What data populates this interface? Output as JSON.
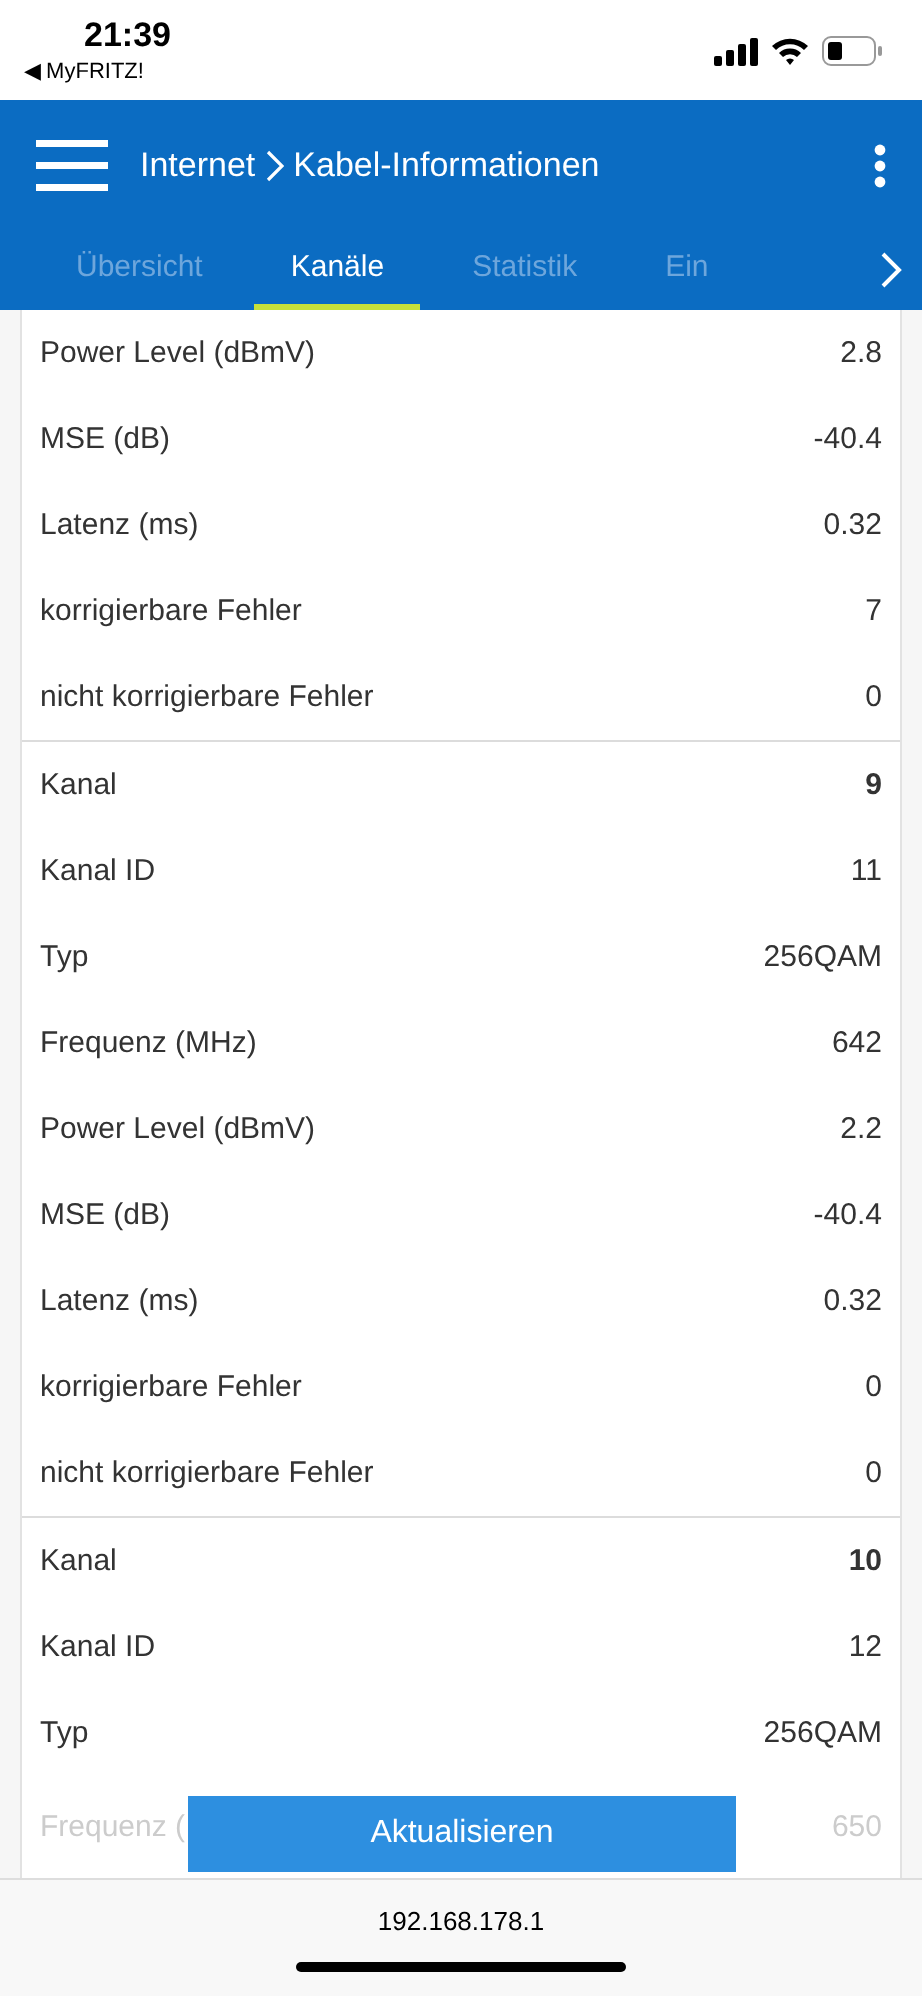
{
  "status_bar": {
    "time": "21:39",
    "back_app": "◀ MyFRITZ!"
  },
  "header": {
    "section": "Internet",
    "title": "Kabel-Informationen"
  },
  "tabs": [
    {
      "label": "Übersicht",
      "selected": false
    },
    {
      "label": "Kanäle",
      "selected": true
    },
    {
      "label": "Statistik",
      "selected": false
    },
    {
      "label": "Ein",
      "selected": false
    }
  ],
  "groups": [
    {
      "rows": [
        {
          "kind": "field",
          "label": "Power Level (dBmV)",
          "value": "2.8"
        },
        {
          "kind": "field",
          "label": "MSE (dB)",
          "value": "-40.4"
        },
        {
          "kind": "field",
          "label": "Latenz (ms)",
          "value": "0.32"
        },
        {
          "kind": "field",
          "label": "korrigierbare Fehler",
          "value": "7"
        },
        {
          "kind": "field",
          "label": "nicht korrigierbare Fehler",
          "value": "0"
        }
      ]
    },
    {
      "rows": [
        {
          "kind": "channel",
          "label": "Kanal",
          "value": "9"
        },
        {
          "kind": "field",
          "label": "Kanal ID",
          "value": "11"
        },
        {
          "kind": "field",
          "label": "Typ",
          "value": "256QAM"
        },
        {
          "kind": "field",
          "label": "Frequenz (MHz)",
          "value": "642"
        },
        {
          "kind": "field",
          "label": "Power Level (dBmV)",
          "value": "2.2"
        },
        {
          "kind": "field",
          "label": "MSE (dB)",
          "value": "-40.4"
        },
        {
          "kind": "field",
          "label": "Latenz (ms)",
          "value": "0.32"
        },
        {
          "kind": "field",
          "label": "korrigierbare Fehler",
          "value": "0"
        },
        {
          "kind": "field",
          "label": "nicht korrigierbare Fehler",
          "value": "0"
        }
      ]
    },
    {
      "rows": [
        {
          "kind": "channel",
          "label": "Kanal",
          "value": "10"
        },
        {
          "kind": "field",
          "label": "Kanal ID",
          "value": "12"
        },
        {
          "kind": "field",
          "label": "Typ",
          "value": "256QAM"
        }
      ]
    }
  ],
  "faded_row": {
    "label": "Frequenz (",
    "value": "650"
  },
  "refresh_button": "Aktualisieren",
  "address_bar": "192.168.178.1"
}
